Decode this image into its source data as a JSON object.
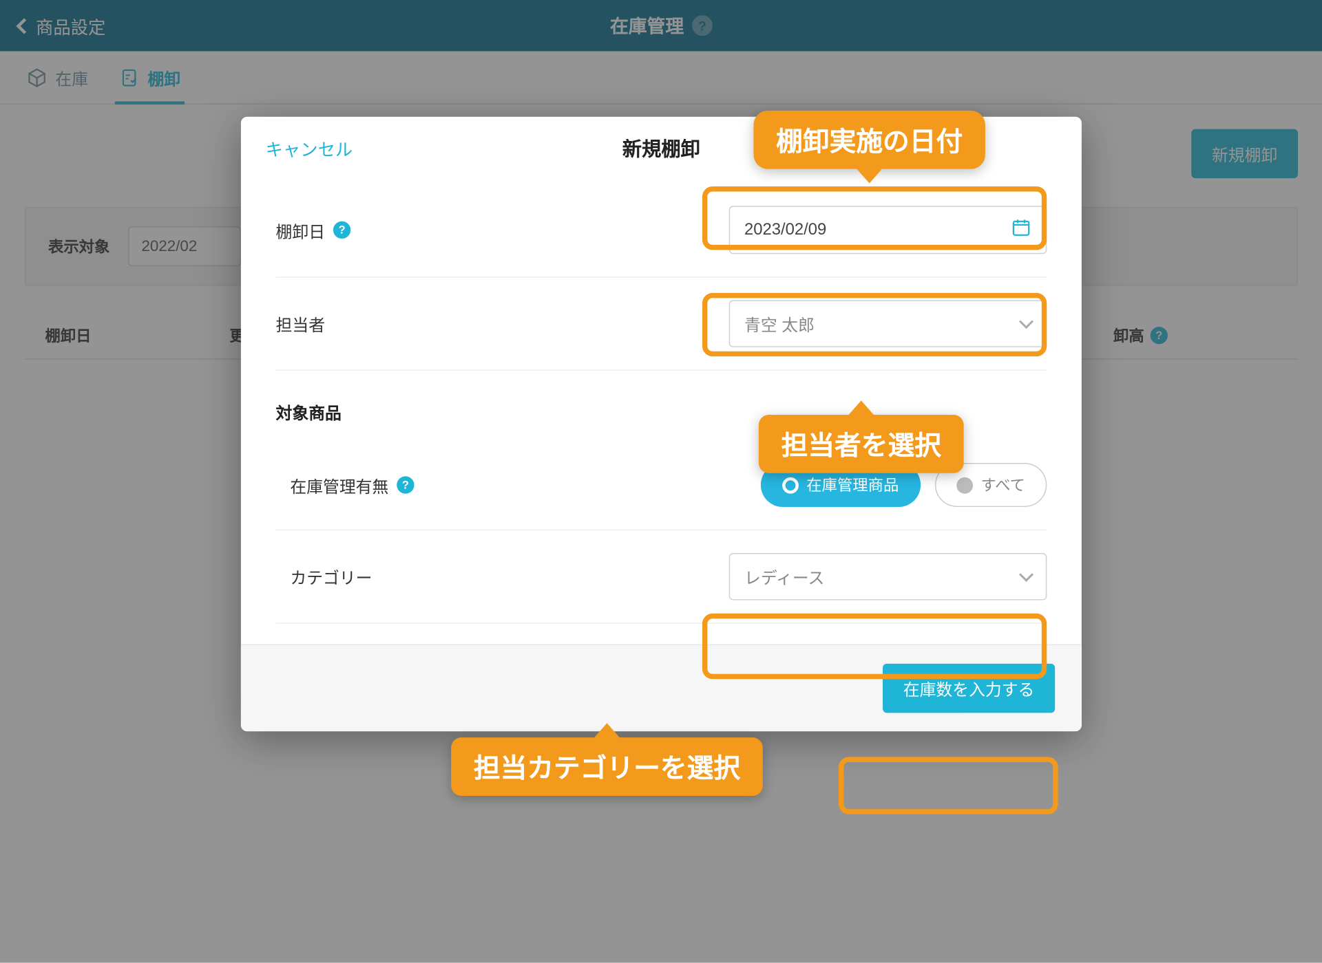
{
  "header": {
    "back_label": "商品設定",
    "title": "在庫管理"
  },
  "tabs": {
    "stock": "在庫",
    "inventory": "棚卸"
  },
  "page": {
    "new_button": "新規棚卸",
    "filter_label": "表示対象",
    "filter_value": "2022/02",
    "col_date": "棚卸日",
    "col_update": "更",
    "col_amount": "卸高"
  },
  "modal": {
    "cancel": "キャンセル",
    "title": "新規棚卸",
    "row_date_label": "棚卸日",
    "row_date_value": "2023/02/09",
    "row_person_label": "担当者",
    "row_person_value": "青空 太郎",
    "section_target": "対象商品",
    "row_managed_label": "在庫管理有無",
    "pill_managed": "在庫管理商品",
    "pill_all": "すべて",
    "row_category_label": "カテゴリー",
    "row_category_value": "レディース",
    "submit": "在庫数を入力する"
  },
  "callouts": {
    "date": "棚卸実施の日付",
    "person": "担当者を選択",
    "category": "担当カテゴリーを選択"
  }
}
